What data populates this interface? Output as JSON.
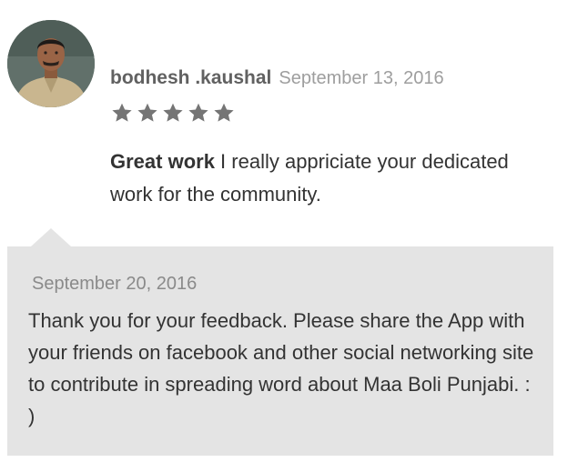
{
  "review": {
    "author": "bodhesh .kaushal",
    "date": "September 13, 2016",
    "rating": 5,
    "max_rating": 5,
    "title": "Great work",
    "text": " I really appriciate your dedicated work for the community."
  },
  "reply": {
    "date": "September 20, 2016",
    "text": "Thank you for your feedback. Please share the App with your friends on facebook and other social networking site to contribute in spreading word about Maa Boli Punjabi. : )"
  },
  "colors": {
    "star": "#757575",
    "reply_background": "#e4e4e4"
  }
}
